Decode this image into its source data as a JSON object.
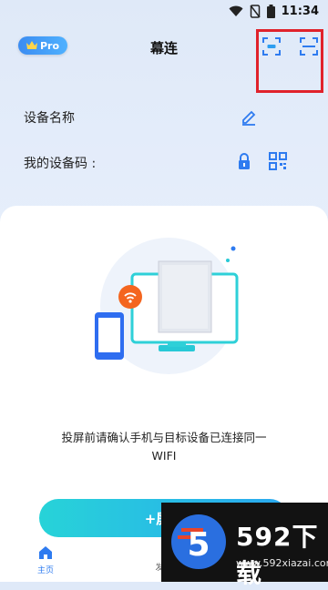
{
  "status_bar": {
    "time": "11:34"
  },
  "header": {
    "title": "幕连",
    "pro_label": "Pro"
  },
  "device": {
    "name_label": "设备名称",
    "code_label": "我的设备码 :"
  },
  "hint": {
    "line1": "投屏前请确认手机与目标设备已连接同一",
    "line2": "WIFI"
  },
  "cast_button": {
    "label": "+屏幕"
  },
  "tabs": [
    {
      "label": "主页"
    },
    {
      "label": "发"
    }
  ],
  "watermark": {
    "title": "592下载",
    "url": "www.592xiazai.com"
  },
  "colors": {
    "accent": "#2e7bf0",
    "highlight": "#e0222b",
    "cast_gradient_start": "#27d3d8",
    "cast_gradient_end": "#2aa8f0"
  },
  "icons": [
    "wifi-icon",
    "no-sim-icon",
    "battery-icon",
    "crown-icon",
    "scan-device-icon",
    "scan-icon",
    "edit-icon",
    "lock-icon",
    "qr-code-icon",
    "home-icon"
  ]
}
